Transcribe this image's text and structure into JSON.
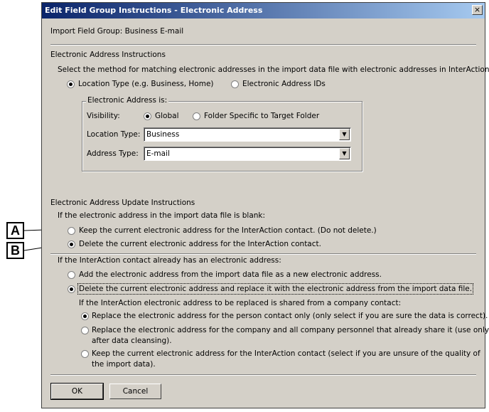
{
  "window": {
    "title": "Edit Field Group Instructions - Electronic Address",
    "close_glyph": "×"
  },
  "import_field_group": "Import Field Group: Business E-mail",
  "instructions": {
    "heading": "Electronic Address Instructions",
    "description": "Select the method for matching electronic addresses in the import data file with electronic addresses in InterAction.",
    "options": [
      {
        "label": "Location Type (e.g. Business, Home)",
        "selected": true
      },
      {
        "label": "Electronic Address IDs",
        "selected": false
      }
    ]
  },
  "address_group": {
    "legend": "Electronic Address is:",
    "visibility_label": "Visibility:",
    "visibility_options": [
      {
        "label": "Global",
        "selected": true
      },
      {
        "label": "Folder Specific to Target Folder",
        "selected": false
      }
    ],
    "location_type_label": "Location Type:",
    "location_type_value": "Business",
    "address_type_label": "Address Type:",
    "address_type_value": "E-mail"
  },
  "update": {
    "heading": "Electronic Address Update Instructions",
    "blank_prompt": "If the electronic address in the import data file is blank:",
    "blank_options": [
      {
        "label": "Keep the current electronic address for the InterAction contact. (Do not delete.)",
        "selected": false
      },
      {
        "label": "Delete the current electronic address for the InterAction contact.",
        "selected": true
      }
    ],
    "existing_prompt": "If the InterAction contact already has an electronic address:",
    "existing_options": [
      {
        "label": "Add the electronic address from the import data file as a new electronic address.",
        "selected": false
      },
      {
        "label": "Delete the current electronic address and replace it with the electronic address from the import data file.",
        "selected": true
      }
    ],
    "shared_prompt": "If the InterAction electronic address to be replaced is shared from a company contact:",
    "shared_options": [
      {
        "label": "Replace the electronic address for the person contact only (only select if you are sure the data is correct).",
        "selected": true
      },
      {
        "label_line1": "Replace the electronic address for the company and all company personnel that already share it (use only",
        "label_line2": "after data cleansing).",
        "selected": false
      },
      {
        "label_line1": "Keep the current electronic address for the InterAction contact (select if you are unsure of the quality of",
        "label_line2": "the import data).",
        "selected": false
      }
    ]
  },
  "buttons": {
    "ok": "OK",
    "cancel": "Cancel"
  },
  "callouts": {
    "a": "A",
    "b": "B"
  }
}
